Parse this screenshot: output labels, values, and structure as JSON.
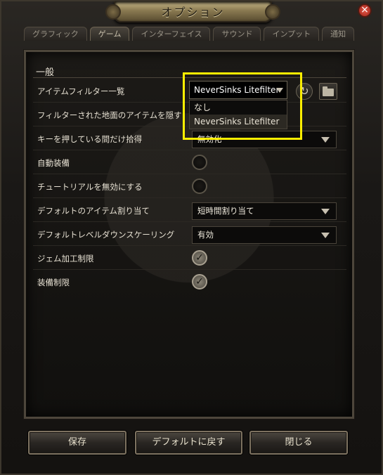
{
  "window": {
    "title": "オプション",
    "close_label": "×"
  },
  "tabs": [
    {
      "label": "グラフィック"
    },
    {
      "label": "ゲーム"
    },
    {
      "label": "インターフェイス"
    },
    {
      "label": "サウンド"
    },
    {
      "label": "インプット"
    },
    {
      "label": "通知"
    }
  ],
  "active_tab": "ゲーム",
  "section": {
    "title": "一般"
  },
  "settings": {
    "item_filter": {
      "label": "アイテムフィルター一覧",
      "value": "NeverSinks Litefilter"
    },
    "hide_ground_items": {
      "label": "フィルターされた地面のアイテムを隠す"
    },
    "hold_to_pickup": {
      "label": "キーを押している間だけ拾得",
      "value": "無効化"
    },
    "auto_equip": {
      "label": "自動装備",
      "checked": false
    },
    "disable_tutorials": {
      "label": "チュートリアルを無効にする",
      "checked": false
    },
    "default_item_allocation": {
      "label": "デフォルトのアイテム割り当て",
      "value": "短時間割り当て"
    },
    "default_level_downscaling": {
      "label": "デフォルトレベルダウンスケーリング",
      "value": "有効"
    },
    "gem_crafting_limit": {
      "label": "ジェム加工制限",
      "checked": true
    },
    "equipment_limit": {
      "label": "装備制限",
      "checked": true
    }
  },
  "filter_dropdown": {
    "options": [
      "なし",
      "NeverSinks Litefilter"
    ],
    "selected": "NeverSinks Litefilter"
  },
  "buttons": {
    "save": "保存",
    "reset_default": "デフォルトに戻す",
    "close": "閉じる"
  },
  "highlight_color": "#ffee00",
  "check_glyph": "✓"
}
